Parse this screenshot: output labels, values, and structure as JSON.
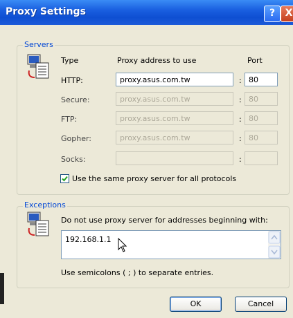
{
  "window": {
    "title": "Proxy Settings",
    "help_glyph": "?",
    "close_glyph": "X"
  },
  "servers": {
    "legend": "Servers",
    "col_type": "Type",
    "col_address": "Proxy address to use",
    "col_port": "Port",
    "rows": [
      {
        "type": "HTTP:",
        "address": "proxy.asus.com.tw",
        "port": "80",
        "enabled": true
      },
      {
        "type": "Secure:",
        "address": "proxy.asus.com.tw",
        "port": "80",
        "enabled": false
      },
      {
        "type": "FTP:",
        "address": "proxy.asus.com.tw",
        "port": "80",
        "enabled": false
      },
      {
        "type": "Gopher:",
        "address": "proxy.asus.com.tw",
        "port": "80",
        "enabled": false
      },
      {
        "type": "Socks:",
        "address": "",
        "port": "",
        "enabled": false
      }
    ],
    "colon": ":",
    "same_proxy_label": "Use the same proxy server for all protocols",
    "same_proxy_checked": true
  },
  "exceptions": {
    "legend": "Exceptions",
    "description": "Do not use proxy server for addresses beginning with:",
    "value": "192.168.1.1",
    "hint": "Use semicolons ( ; ) to separate entries."
  },
  "buttons": {
    "ok": "OK",
    "cancel": "Cancel"
  },
  "icons": {
    "servers": "computer-network-icon",
    "exceptions": "computer-network-icon",
    "cursor": "mouse-pointer-icon"
  }
}
